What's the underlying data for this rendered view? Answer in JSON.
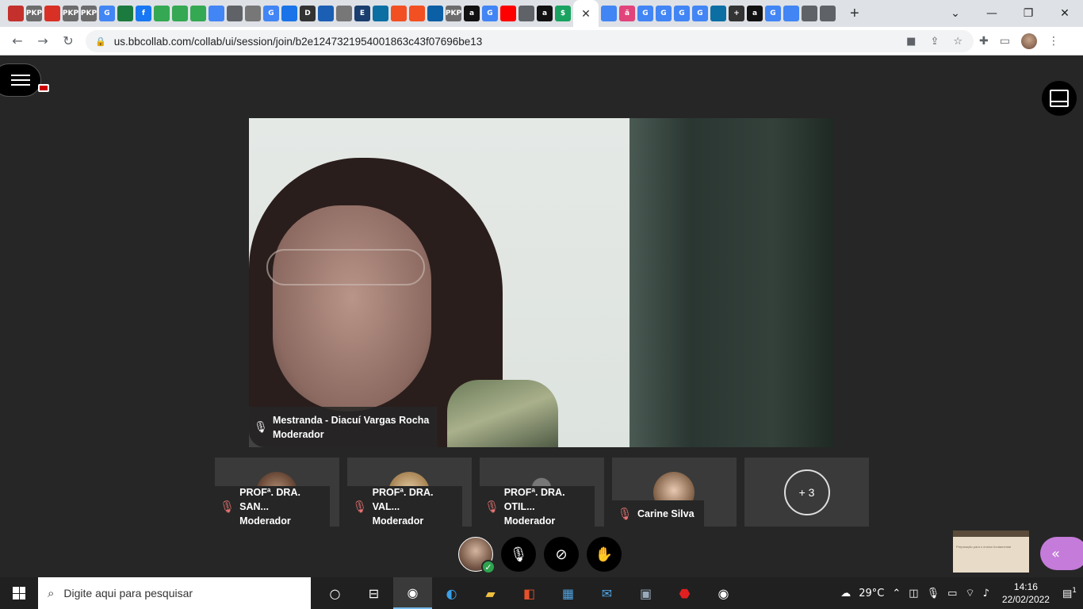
{
  "browser": {
    "active_tab_close": "✕",
    "new_tab": "+",
    "url": "us.bbcollab.com/collab/ui/session/join/b2e1247321954001863c43f07696be13",
    "tab_icons": [
      {
        "label": "",
        "color": "#c4302b"
      },
      {
        "label": "PKP",
        "color": "#6c6c6c"
      },
      {
        "label": "",
        "color": "#d93025"
      },
      {
        "label": "PKP",
        "color": "#6c6c6c"
      },
      {
        "label": "PKP",
        "color": "#6c6c6c"
      },
      {
        "label": "G",
        "color": "#4285f4"
      },
      {
        "label": "",
        "color": "#1b7a3e"
      },
      {
        "label": "f",
        "color": "#1877f2"
      },
      {
        "label": "",
        "color": "#34a853"
      },
      {
        "label": "",
        "color": "#34a853"
      },
      {
        "label": "",
        "color": "#34a853"
      },
      {
        "label": "",
        "color": "#4285f4"
      },
      {
        "label": "",
        "color": "#5f6368"
      },
      {
        "label": "",
        "color": "#777"
      },
      {
        "label": "G",
        "color": "#4285f4"
      },
      {
        "label": "",
        "color": "#1a73e8"
      },
      {
        "label": "D",
        "color": "#333"
      },
      {
        "label": "",
        "color": "#1a5fb4"
      },
      {
        "label": "",
        "color": "#777"
      },
      {
        "label": "E",
        "color": "#1a3e6e"
      },
      {
        "label": "",
        "color": "#0b6fa4"
      },
      {
        "label": "",
        "color": "#f25022"
      },
      {
        "label": "",
        "color": "#f25022"
      },
      {
        "label": "",
        "color": "#0b5fa4"
      },
      {
        "label": "PKP",
        "color": "#6c6c6c"
      },
      {
        "label": "a",
        "color": "#111"
      },
      {
        "label": "G",
        "color": "#4285f4"
      },
      {
        "label": "",
        "color": "#ff0000"
      },
      {
        "label": "",
        "color": "#5f6368"
      },
      {
        "label": "a",
        "color": "#111"
      },
      {
        "label": "$",
        "color": "#1aa260"
      }
    ],
    "tab_icons_right": [
      {
        "label": "",
        "color": "#4285f4"
      },
      {
        "label": "ã",
        "color": "#e0447a"
      },
      {
        "label": "G",
        "color": "#4285f4"
      },
      {
        "label": "G",
        "color": "#4285f4"
      },
      {
        "label": "G",
        "color": "#4285f4"
      },
      {
        "label": "G",
        "color": "#4285f4"
      },
      {
        "label": "",
        "color": "#0b6fa4"
      },
      {
        "label": "+",
        "color": "#333"
      },
      {
        "label": "a",
        "color": "#111"
      },
      {
        "label": "G",
        "color": "#4285f4"
      },
      {
        "label": "",
        "color": "#4285f4"
      },
      {
        "label": "",
        "color": "#5f6368"
      },
      {
        "label": "",
        "color": "#5f6368"
      }
    ]
  },
  "session": {
    "main_speaker": {
      "name": "Mestranda - Diacuí Vargas Rocha",
      "role": "Moderador"
    },
    "participants": [
      {
        "name": "PROFª. DRA. SAN...",
        "role": "Moderador"
      },
      {
        "name": "PROFª. DRA. VAL...",
        "role": "Moderador"
      },
      {
        "name": "PROFª. DRA. OTIL...",
        "role": "Moderador"
      },
      {
        "name": "Carine Silva",
        "role": ""
      }
    ],
    "more_count": "+ 3"
  },
  "taskbar": {
    "search_placeholder": "Digite aqui para pesquisar",
    "weather": "29°C",
    "time": "14:16",
    "date": "22/02/2022",
    "notifications": "1"
  },
  "slide": {
    "title": "Preparação para o ensino fundamental"
  }
}
